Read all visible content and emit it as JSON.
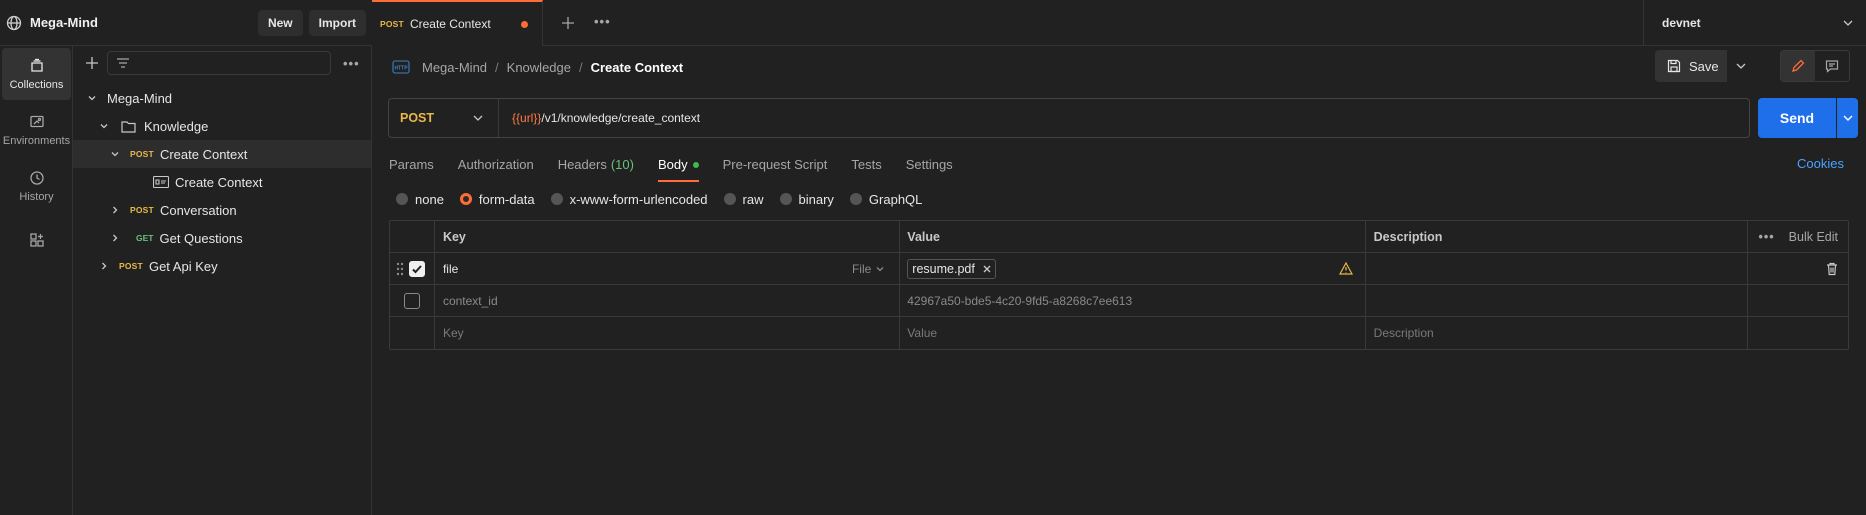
{
  "workspace": {
    "name": "Mega-Mind",
    "new_label": "New",
    "import_label": "Import"
  },
  "rail": [
    {
      "label": "Collections",
      "icon": "collections-icon"
    },
    {
      "label": "Environments",
      "icon": "environments-icon"
    },
    {
      "label": "History",
      "icon": "history-icon"
    },
    {
      "label": "",
      "icon": "apps-icon"
    }
  ],
  "tree": {
    "collection": "Mega-Mind",
    "folder": "Knowledge",
    "req1": {
      "method": "POST",
      "name": "Create Context"
    },
    "example": "Create Context",
    "req2": {
      "method": "POST",
      "name": "Conversation"
    },
    "req3": {
      "method": "GET",
      "name": "Get Questions"
    },
    "req4": {
      "method": "POST",
      "name": "Get Api Key"
    }
  },
  "tab": {
    "method": "POST",
    "label": "Create Context"
  },
  "environment": "devnet",
  "breadcrumb": {
    "root": "Mega-Mind",
    "folder": "Knowledge",
    "current": "Create Context",
    "sep": "/"
  },
  "save_label": "Save",
  "request": {
    "method": "POST",
    "url_var": "{{url}}",
    "url_path": "/v1/knowledge/create_context"
  },
  "send_label": "Send",
  "req_tabs": {
    "params": "Params",
    "authorization": "Authorization",
    "headers": "Headers",
    "headers_count": "(10)",
    "body": "Body",
    "prerequest": "Pre-request Script",
    "tests": "Tests",
    "settings": "Settings"
  },
  "cookies_label": "Cookies",
  "body_types": {
    "none": "none",
    "form_data": "form-data",
    "urlencoded": "x-www-form-urlencoded",
    "raw": "raw",
    "binary": "binary",
    "graphql": "GraphQL",
    "selected": "form-data"
  },
  "table": {
    "headers": {
      "key": "Key",
      "value": "Value",
      "description": "Description",
      "bulk": "Bulk Edit"
    },
    "row1": {
      "checked": true,
      "key": "file",
      "type": "File",
      "value": "resume.pdf"
    },
    "row2": {
      "checked": false,
      "key": "context_id",
      "value": "42967a50-bde5-4c20-9fd5-a8268c7ee613"
    },
    "placeholders": {
      "key": "Key",
      "value": "Value",
      "description": "Description"
    }
  },
  "colors": {
    "accent": "#ff6c37",
    "post": "#e8b84a",
    "get": "#6bbf7a",
    "send": "#1f6feb",
    "link": "#4aa3ff"
  }
}
